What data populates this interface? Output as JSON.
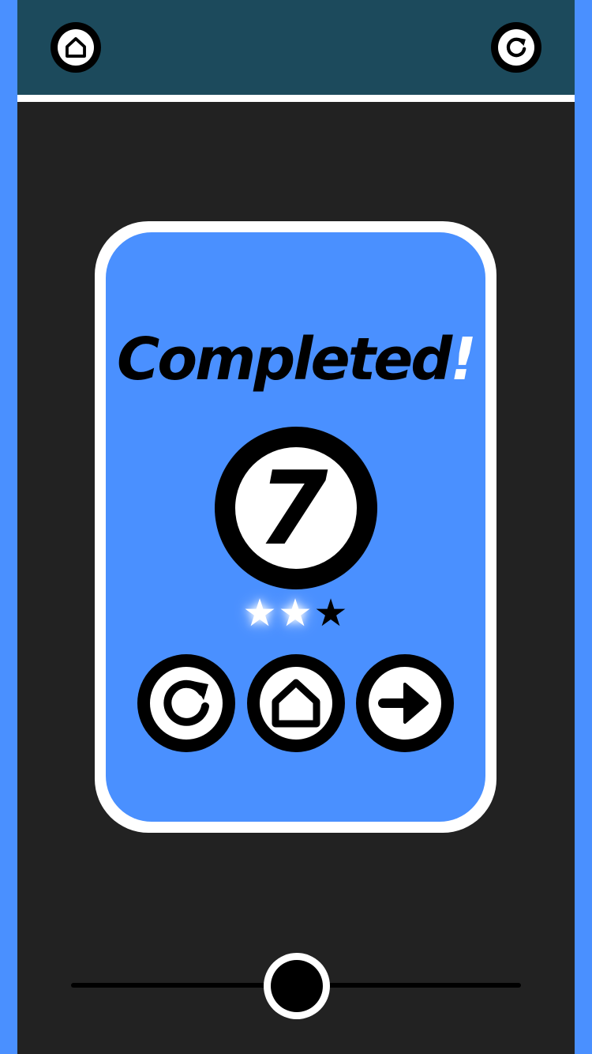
{
  "header": {
    "home_icon": "home-icon",
    "restart_icon": "restart-icon"
  },
  "result": {
    "title_main": "Completed",
    "title_bang": "!",
    "level": "7",
    "stars_earned": 2,
    "stars_total": 3
  },
  "actions": {
    "restart_icon": "restart-icon",
    "home_icon": "home-icon",
    "next_icon": "arrow-right-icon"
  },
  "slider": {
    "value": 0.5
  },
  "colors": {
    "background_blue": "#4a90ff",
    "stage": "#222222",
    "topbar": "#1c4a5c",
    "card_blue": "#4a90ff",
    "black": "#000000",
    "white": "#ffffff"
  }
}
